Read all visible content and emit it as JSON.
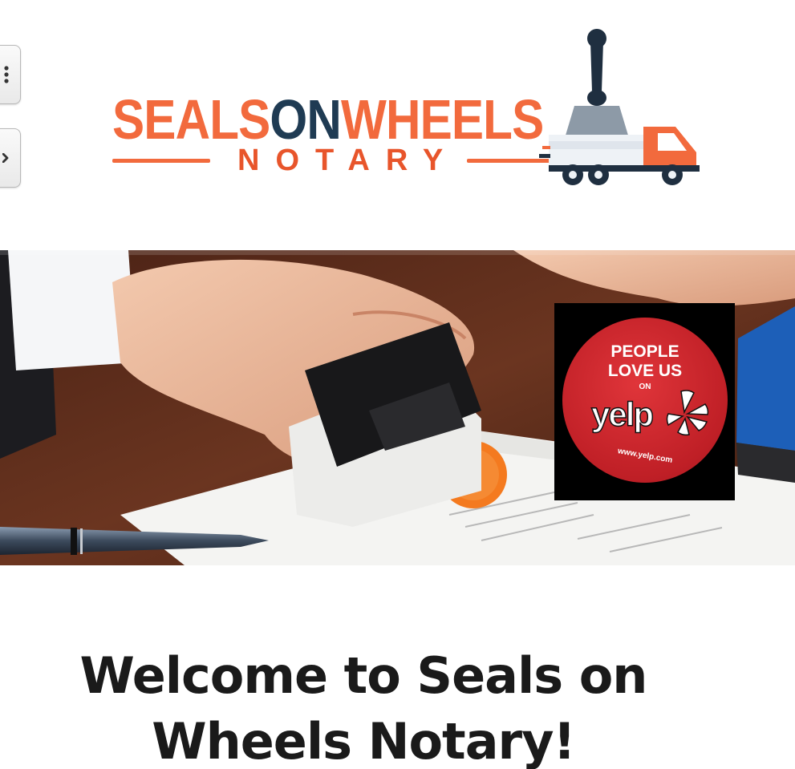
{
  "controls": {
    "menu_icon": "menu-icon",
    "nav_icon": "chevron-right-icon"
  },
  "logo": {
    "word_part1": "SEALS",
    "word_part2": "ON",
    "word_part3": "WHEELS",
    "subtitle": "NOTARY",
    "colors": {
      "orange": "#f26a3d",
      "navy": "#1f3b53"
    }
  },
  "hero": {
    "badge": {
      "line1": "PEOPLE",
      "line2": "LOVE US",
      "on": "ON",
      "brand": "yelp",
      "url": "www.yelp.com",
      "color": "#c4222a"
    }
  },
  "content": {
    "heading": "Welcome to Seals on Wheels Notary!"
  }
}
